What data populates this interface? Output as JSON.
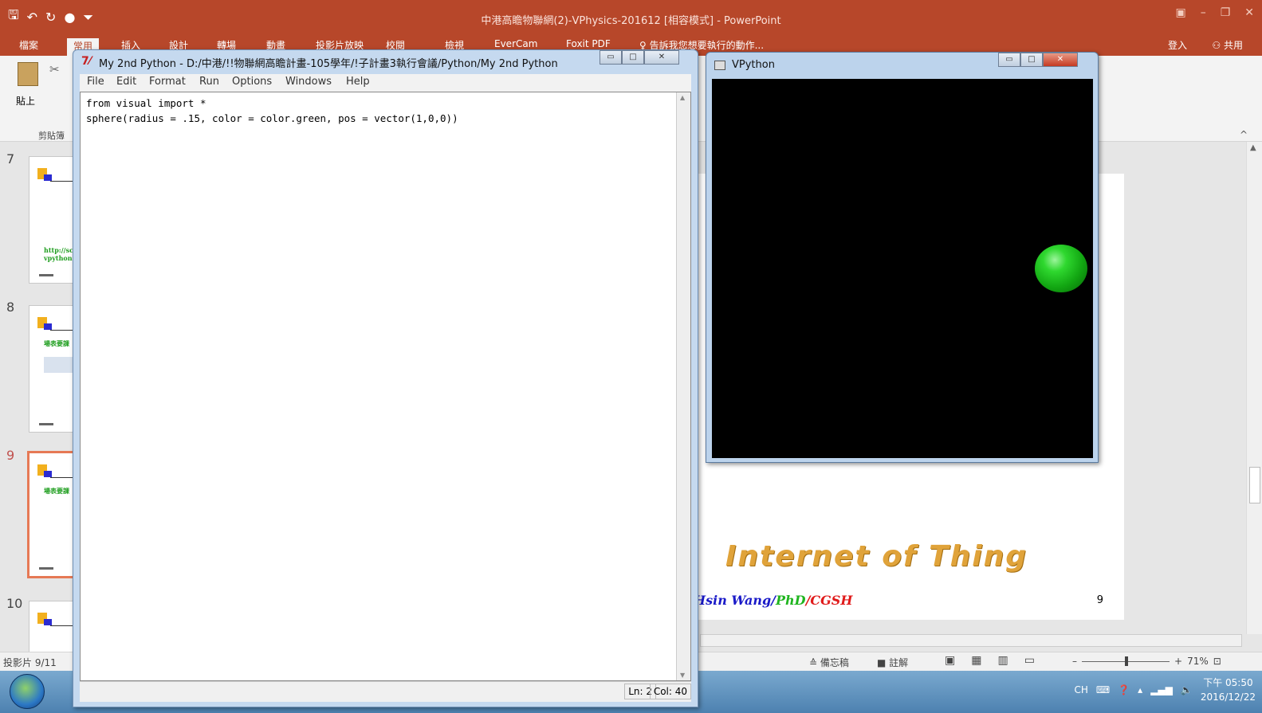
{
  "powerpoint": {
    "title": "中港高瞻物聯網(2)-VPhysics-201612 [相容模式] - PowerPoint",
    "tabs": [
      "檔案",
      "常用",
      "插入",
      "設計",
      "轉場",
      "動畫",
      "投影片放映",
      "校閱",
      "檢視",
      "EverCam",
      "Foxit PDF",
      "♀ 告訴我您想要執行的動作..."
    ],
    "signin": "登入",
    "share": "共用",
    "paste_label": "貼上",
    "clipboard_label": "剪貼簿",
    "thumb_numbers": [
      "7",
      "8",
      "9",
      "10"
    ],
    "thumb7_text_1": "http://scj",
    "thumb7_text_2": "vpython",
    "thumb8_text": "場表要課",
    "thumb9_text": "場表要課",
    "slide_heading": "Internet of Thing",
    "slide_author_1": "Hsin Wang/",
    "slide_author_2": "PhD",
    "slide_author_3": "/CGSH",
    "slide_page_number": "9",
    "status_slide": "投影片 9/11",
    "notes_label": "≙ 備忘稿",
    "comments_label": "■ 註解",
    "zoom_percent": "71%"
  },
  "idle": {
    "title": "My 2nd Python - D:/中港/!!物聯網高瞻計畫-105學年/!子計畫3執行會議/Python/My 2nd Python",
    "menu": [
      "File",
      "Edit",
      "Format",
      "Run",
      "Options",
      "Windows",
      "Help"
    ],
    "code_line_1": "from visual import *",
    "code_line_2": "sphere(radius = .15, color = color.green, pos = vector(1,0,0))",
    "ln": "Ln: 2",
    "col": "Col: 40"
  },
  "vpython": {
    "title": "VPython",
    "sphere_color": "#22cc22"
  },
  "taskbar": {
    "input_lang": "CH",
    "time": "下午 05:50",
    "date": "2016/12/22"
  }
}
